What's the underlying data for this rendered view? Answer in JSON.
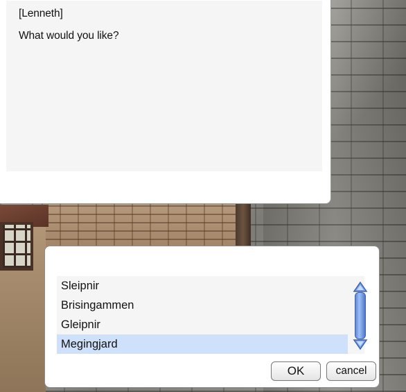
{
  "dialog": {
    "speaker": "[Lenneth]",
    "message": "What would you like?"
  },
  "menu": {
    "items": [
      {
        "label": "Sleipnir",
        "selected": false
      },
      {
        "label": "Brisingammen",
        "selected": false
      },
      {
        "label": "Gleipnir",
        "selected": false
      },
      {
        "label": "Megingjard",
        "selected": true
      }
    ],
    "ok_label": "OK",
    "cancel_label": "cancel"
  },
  "colors": {
    "selection": "#cfe0fa",
    "scrollbar": "#5e86d8",
    "panel": "#f5f5f5"
  }
}
